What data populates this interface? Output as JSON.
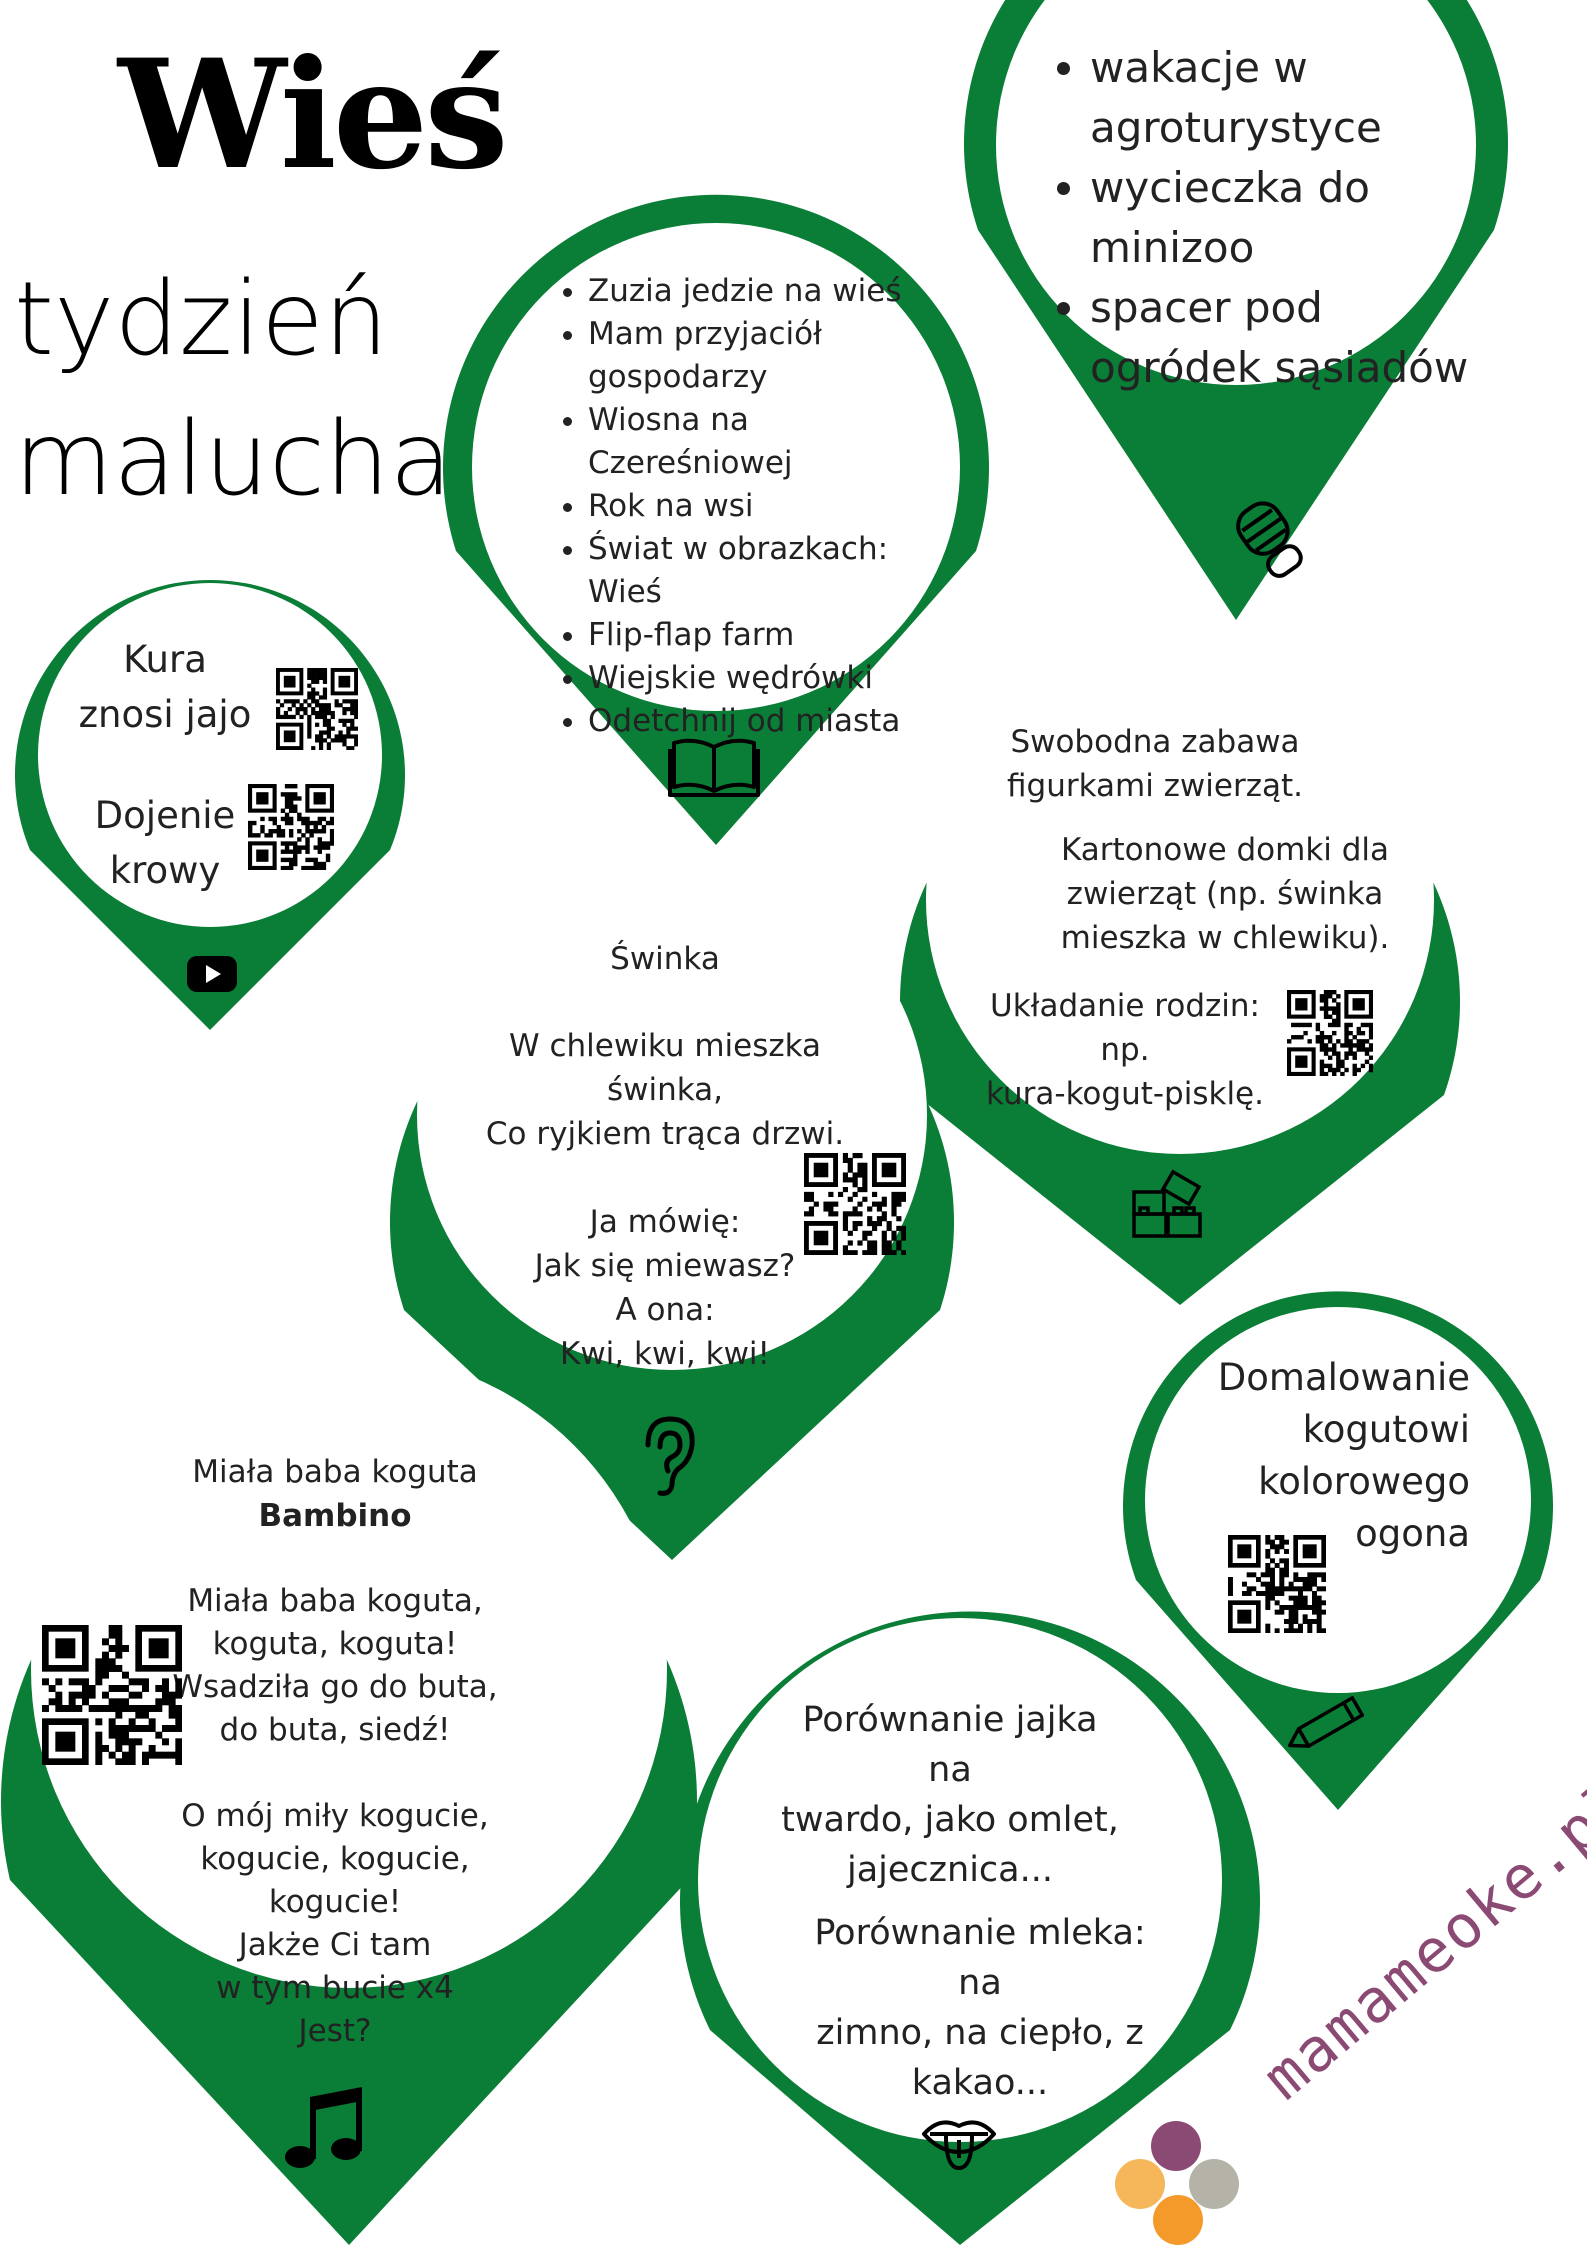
{
  "title": {
    "main": "Wieś",
    "line1": "tydzień",
    "line2": "malucha"
  },
  "colors": {
    "pin": "#0a7d36",
    "text": "#1a1a1a",
    "brand": "#8a4a73",
    "logo": [
      "#8a4a73",
      "#f6b75a",
      "#b5b3a8",
      "#f39a2a"
    ]
  },
  "pins": {
    "activities": {
      "icon": "footprint-icon",
      "items": [
        "wakacje w agroturystyce",
        "wycieczka do minizoo",
        "spacer pod ogródek sąsiadów"
      ]
    },
    "books": {
      "icon": "book-icon",
      "items": [
        "Zuzia jedzie na wieś",
        "Mam przyjaciół gospodarzy",
        "Wiosna na Czereśniowej",
        "Rok na wsi",
        "Świat w obrazkach: Wieś",
        "Flip-flap farm",
        "Wiejskie wędrówki",
        "Odetchnij od miasta"
      ]
    },
    "videos": {
      "icon": "youtube-icon",
      "item1_l1": "Kura",
      "item1_l2": "znosi jajo",
      "item2_l1": "Dojenie",
      "item2_l2": "krowy"
    },
    "play": {
      "icon": "blocks-icon",
      "p1_l1": "Swobodna zabawa",
      "p1_l2": "figurkami zwierząt.",
      "p2_l1": "Kartonowe domki dla",
      "p2_l2": "zwierząt (np. świnka",
      "p2_l3": "mieszka w chlewiku).",
      "p3_l1": "Układanie rodzin: np.",
      "p3_l2": "kura-kogut-pisklę."
    },
    "poem": {
      "icon": "ear-icon",
      "title": "Świnka",
      "lines": [
        "W chlewiku mieszka",
        "świnka,",
        "Co ryjkiem trąca drzwi.",
        "",
        "Ja mówię:",
        "Jak się miewasz?",
        "A ona:",
        "Kwi, kwi, kwi!"
      ]
    },
    "song": {
      "icon": "music-note-icon",
      "title": "Miała baba koguta",
      "author": "Bambino",
      "lines": [
        "Miała baba koguta,",
        "koguta, koguta!",
        "Wsadziła go do buta,",
        "do buta, siedź!",
        "",
        "O mój miły kogucie,",
        "kogucie, kogucie, kogucie!",
        "Jakże Ci tam",
        "w tym bucie x4",
        "Jest?"
      ]
    },
    "art": {
      "icon": "pencil-icon",
      "lines": [
        "Domalowanie",
        "kogutowi",
        "kolorowego ogona"
      ]
    },
    "taste": {
      "icon": "tongue-icon",
      "p1": [
        "Porównanie jajka na",
        "twardo, jako omlet,",
        "jajecznica..."
      ],
      "p2": [
        "Porównanie mleka: na",
        "zimno, na ciepło, z",
        "kakao..."
      ]
    }
  },
  "brand": "mamameoke.pl"
}
